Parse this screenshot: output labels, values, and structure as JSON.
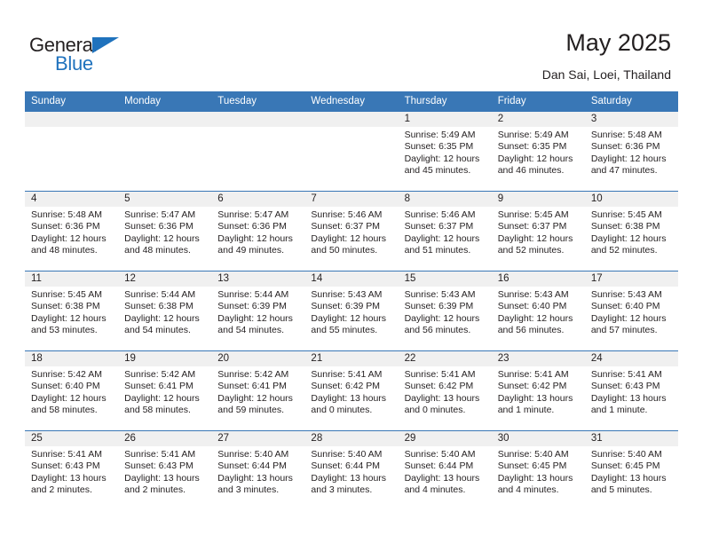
{
  "brand": {
    "name_top": "General",
    "name_bottom": "Blue",
    "triangle_color": "#1f72bd",
    "text_color": "#231f20"
  },
  "header": {
    "title": "May 2025",
    "subtitle": "Dan Sai, Loei, Thailand"
  },
  "colors": {
    "header_blue": "#3977b6",
    "daynum_band": "#f0f0f0",
    "text": "#231f20",
    "row_border": "#3977b6"
  },
  "calendar": {
    "weekday_headers": [
      "Sunday",
      "Monday",
      "Tuesday",
      "Wednesday",
      "Thursday",
      "Friday",
      "Saturday"
    ],
    "weeks": [
      [
        {
          "day": "",
          "sunrise": "",
          "sunset": "",
          "daylight_line1": "",
          "daylight_line2": ""
        },
        {
          "day": "",
          "sunrise": "",
          "sunset": "",
          "daylight_line1": "",
          "daylight_line2": ""
        },
        {
          "day": "",
          "sunrise": "",
          "sunset": "",
          "daylight_line1": "",
          "daylight_line2": ""
        },
        {
          "day": "",
          "sunrise": "",
          "sunset": "",
          "daylight_line1": "",
          "daylight_line2": ""
        },
        {
          "day": "1",
          "sunrise": "Sunrise: 5:49 AM",
          "sunset": "Sunset: 6:35 PM",
          "daylight_line1": "Daylight: 12 hours",
          "daylight_line2": "and 45 minutes."
        },
        {
          "day": "2",
          "sunrise": "Sunrise: 5:49 AM",
          "sunset": "Sunset: 6:35 PM",
          "daylight_line1": "Daylight: 12 hours",
          "daylight_line2": "and 46 minutes."
        },
        {
          "day": "3",
          "sunrise": "Sunrise: 5:48 AM",
          "sunset": "Sunset: 6:36 PM",
          "daylight_line1": "Daylight: 12 hours",
          "daylight_line2": "and 47 minutes."
        }
      ],
      [
        {
          "day": "4",
          "sunrise": "Sunrise: 5:48 AM",
          "sunset": "Sunset: 6:36 PM",
          "daylight_line1": "Daylight: 12 hours",
          "daylight_line2": "and 48 minutes."
        },
        {
          "day": "5",
          "sunrise": "Sunrise: 5:47 AM",
          "sunset": "Sunset: 6:36 PM",
          "daylight_line1": "Daylight: 12 hours",
          "daylight_line2": "and 48 minutes."
        },
        {
          "day": "6",
          "sunrise": "Sunrise: 5:47 AM",
          "sunset": "Sunset: 6:36 PM",
          "daylight_line1": "Daylight: 12 hours",
          "daylight_line2": "and 49 minutes."
        },
        {
          "day": "7",
          "sunrise": "Sunrise: 5:46 AM",
          "sunset": "Sunset: 6:37 PM",
          "daylight_line1": "Daylight: 12 hours",
          "daylight_line2": "and 50 minutes."
        },
        {
          "day": "8",
          "sunrise": "Sunrise: 5:46 AM",
          "sunset": "Sunset: 6:37 PM",
          "daylight_line1": "Daylight: 12 hours",
          "daylight_line2": "and 51 minutes."
        },
        {
          "day": "9",
          "sunrise": "Sunrise: 5:45 AM",
          "sunset": "Sunset: 6:37 PM",
          "daylight_line1": "Daylight: 12 hours",
          "daylight_line2": "and 52 minutes."
        },
        {
          "day": "10",
          "sunrise": "Sunrise: 5:45 AM",
          "sunset": "Sunset: 6:38 PM",
          "daylight_line1": "Daylight: 12 hours",
          "daylight_line2": "and 52 minutes."
        }
      ],
      [
        {
          "day": "11",
          "sunrise": "Sunrise: 5:45 AM",
          "sunset": "Sunset: 6:38 PM",
          "daylight_line1": "Daylight: 12 hours",
          "daylight_line2": "and 53 minutes."
        },
        {
          "day": "12",
          "sunrise": "Sunrise: 5:44 AM",
          "sunset": "Sunset: 6:38 PM",
          "daylight_line1": "Daylight: 12 hours",
          "daylight_line2": "and 54 minutes."
        },
        {
          "day": "13",
          "sunrise": "Sunrise: 5:44 AM",
          "sunset": "Sunset: 6:39 PM",
          "daylight_line1": "Daylight: 12 hours",
          "daylight_line2": "and 54 minutes."
        },
        {
          "day": "14",
          "sunrise": "Sunrise: 5:43 AM",
          "sunset": "Sunset: 6:39 PM",
          "daylight_line1": "Daylight: 12 hours",
          "daylight_line2": "and 55 minutes."
        },
        {
          "day": "15",
          "sunrise": "Sunrise: 5:43 AM",
          "sunset": "Sunset: 6:39 PM",
          "daylight_line1": "Daylight: 12 hours",
          "daylight_line2": "and 56 minutes."
        },
        {
          "day": "16",
          "sunrise": "Sunrise: 5:43 AM",
          "sunset": "Sunset: 6:40 PM",
          "daylight_line1": "Daylight: 12 hours",
          "daylight_line2": "and 56 minutes."
        },
        {
          "day": "17",
          "sunrise": "Sunrise: 5:43 AM",
          "sunset": "Sunset: 6:40 PM",
          "daylight_line1": "Daylight: 12 hours",
          "daylight_line2": "and 57 minutes."
        }
      ],
      [
        {
          "day": "18",
          "sunrise": "Sunrise: 5:42 AM",
          "sunset": "Sunset: 6:40 PM",
          "daylight_line1": "Daylight: 12 hours",
          "daylight_line2": "and 58 minutes."
        },
        {
          "day": "19",
          "sunrise": "Sunrise: 5:42 AM",
          "sunset": "Sunset: 6:41 PM",
          "daylight_line1": "Daylight: 12 hours",
          "daylight_line2": "and 58 minutes."
        },
        {
          "day": "20",
          "sunrise": "Sunrise: 5:42 AM",
          "sunset": "Sunset: 6:41 PM",
          "daylight_line1": "Daylight: 12 hours",
          "daylight_line2": "and 59 minutes."
        },
        {
          "day": "21",
          "sunrise": "Sunrise: 5:41 AM",
          "sunset": "Sunset: 6:42 PM",
          "daylight_line1": "Daylight: 13 hours",
          "daylight_line2": "and 0 minutes."
        },
        {
          "day": "22",
          "sunrise": "Sunrise: 5:41 AM",
          "sunset": "Sunset: 6:42 PM",
          "daylight_line1": "Daylight: 13 hours",
          "daylight_line2": "and 0 minutes."
        },
        {
          "day": "23",
          "sunrise": "Sunrise: 5:41 AM",
          "sunset": "Sunset: 6:42 PM",
          "daylight_line1": "Daylight: 13 hours",
          "daylight_line2": "and 1 minute."
        },
        {
          "day": "24",
          "sunrise": "Sunrise: 5:41 AM",
          "sunset": "Sunset: 6:43 PM",
          "daylight_line1": "Daylight: 13 hours",
          "daylight_line2": "and 1 minute."
        }
      ],
      [
        {
          "day": "25",
          "sunrise": "Sunrise: 5:41 AM",
          "sunset": "Sunset: 6:43 PM",
          "daylight_line1": "Daylight: 13 hours",
          "daylight_line2": "and 2 minutes."
        },
        {
          "day": "26",
          "sunrise": "Sunrise: 5:41 AM",
          "sunset": "Sunset: 6:43 PM",
          "daylight_line1": "Daylight: 13 hours",
          "daylight_line2": "and 2 minutes."
        },
        {
          "day": "27",
          "sunrise": "Sunrise: 5:40 AM",
          "sunset": "Sunset: 6:44 PM",
          "daylight_line1": "Daylight: 13 hours",
          "daylight_line2": "and 3 minutes."
        },
        {
          "day": "28",
          "sunrise": "Sunrise: 5:40 AM",
          "sunset": "Sunset: 6:44 PM",
          "daylight_line1": "Daylight: 13 hours",
          "daylight_line2": "and 3 minutes."
        },
        {
          "day": "29",
          "sunrise": "Sunrise: 5:40 AM",
          "sunset": "Sunset: 6:44 PM",
          "daylight_line1": "Daylight: 13 hours",
          "daylight_line2": "and 4 minutes."
        },
        {
          "day": "30",
          "sunrise": "Sunrise: 5:40 AM",
          "sunset": "Sunset: 6:45 PM",
          "daylight_line1": "Daylight: 13 hours",
          "daylight_line2": "and 4 minutes."
        },
        {
          "day": "31",
          "sunrise": "Sunrise: 5:40 AM",
          "sunset": "Sunset: 6:45 PM",
          "daylight_line1": "Daylight: 13 hours",
          "daylight_line2": "and 5 minutes."
        }
      ]
    ]
  }
}
